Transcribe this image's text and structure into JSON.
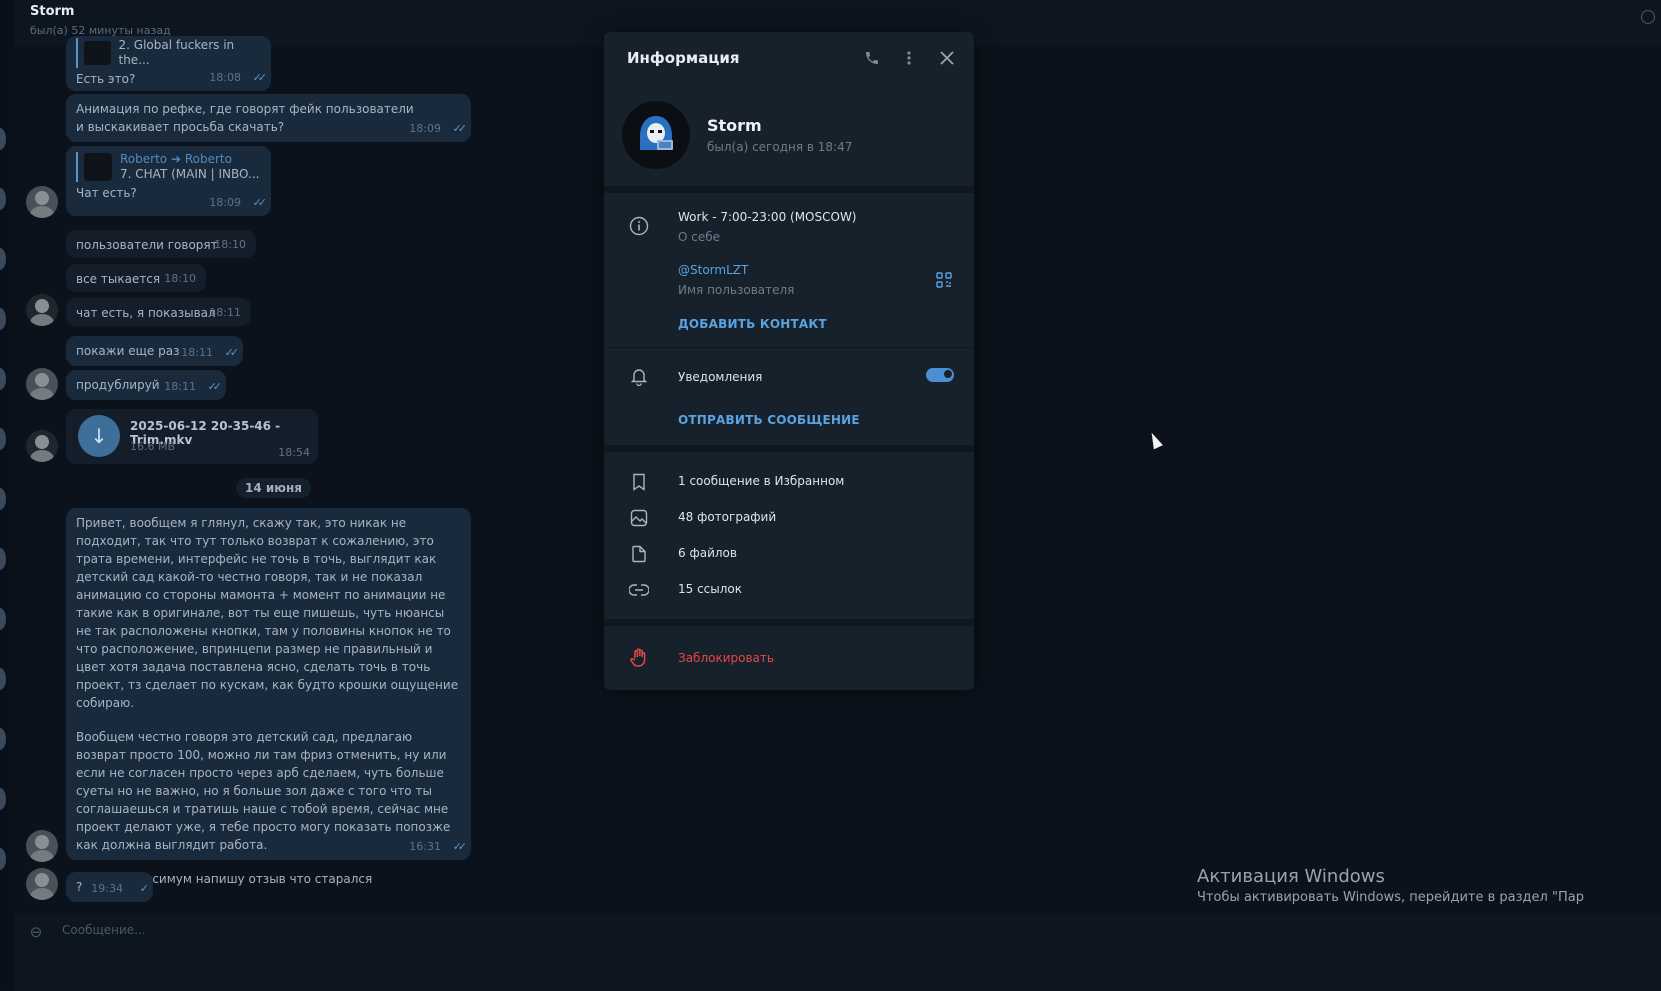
{
  "header": {
    "name": "Storm",
    "status": "был(а) 52 минуты назад"
  },
  "messages": {
    "m1": {
      "reply_preview": "2. Global fuckers in the...",
      "text": "Есть это?",
      "time": "18:08"
    },
    "m2": {
      "text": "Анимация по рефке, где говорят фейк пользователи и выскакивает просьба скачать?",
      "time": "18:09"
    },
    "m3": {
      "reply_from": "Roberto",
      "reply_arrow": "➔",
      "reply_to": "Roberto",
      "reply_preview": "7. CHAT (MAIN | INBO...",
      "text": "Чат есть?",
      "time": "18:09"
    },
    "m4": {
      "text": "пользователи говорят",
      "time": "18:10"
    },
    "m5": {
      "text": "все тыкается",
      "time": "18:10"
    },
    "m6": {
      "text": "чат есть, я показывал",
      "time": "18:11"
    },
    "m7": {
      "text": "покажи еще раз",
      "time": "18:11"
    },
    "m8": {
      "text": "продублируй",
      "time": "18:11"
    },
    "file": {
      "name": "2025-06-12 20-35-46 - Trim.mkv",
      "size": "16.6 MB",
      "time": "18:54"
    },
    "date_divider": "14 июня",
    "long": {
      "p1": "Привет, вообщем я глянул, скажу так, это никак не подходит, так что тут только возврат к сожалению, это трата времени, интерфейс не точь в точь, выглядит как детский сад какой-то честно говоря, так и не показал анимацию со стороны мамонта + момент по анимации не такие как в оригинале, вот ты еще пишешь, чуть нюансы не так расположены кнопки, там у половины кнопок не то что расположение, впринцепи размер не правильный и цвет хотя задача поставлена ясно, сделать точь в точь проект, тз сделает по кускам, как будто крошки ощущение собираю.",
      "p2": "Вообщем честно говоря это детский сад, предлагаю возврат просто 100, можно ли там фриз отменить, ну или если не согласен просто через арб сделаем, чуть больше суеты но не важно, но я больше зол даже с того что ты соглашаешься и тратишь наше с тобой время, сейчас мне проект делают уже, я тебе просто могу показать попозже как должна выглядит работа.",
      "p3": "От себя максимум напишу отзыв что старался",
      "time": "16:31"
    },
    "last": {
      "text": "?",
      "time": "19:34"
    }
  },
  "composer": {
    "placeholder": "Сообщение..."
  },
  "panel": {
    "title": "Информация",
    "profile": {
      "name": "Storm",
      "status": "был(а) сегодня в 18:47"
    },
    "bio": {
      "value": "Work - 7:00-23:00 (MOSCOW)",
      "label": "О себе"
    },
    "username": {
      "value": "@StormLZT",
      "label": "Имя пользователя"
    },
    "add_contact": "ДОБАВИТЬ КОНТАКТ",
    "notifications": {
      "label": "Уведомления",
      "enabled": true
    },
    "send_message": "ОТПРАВИТЬ СООБЩЕНИЕ",
    "media": {
      "saved": "1 сообщение в Избранном",
      "photos": "48 фотографий",
      "files": "6 файлов",
      "links": "15 ссылок"
    },
    "block": "Заблокировать"
  },
  "watermark": {
    "title": "Активация Windows",
    "subtitle": "Чтобы активировать Windows, перейдите в раздел \"Пар"
  },
  "colors": {
    "accent": "#5aa3e0",
    "danger": "#e54747",
    "panel_bg": "#17212b",
    "outgoing_bubble": "#1a2a3d"
  }
}
